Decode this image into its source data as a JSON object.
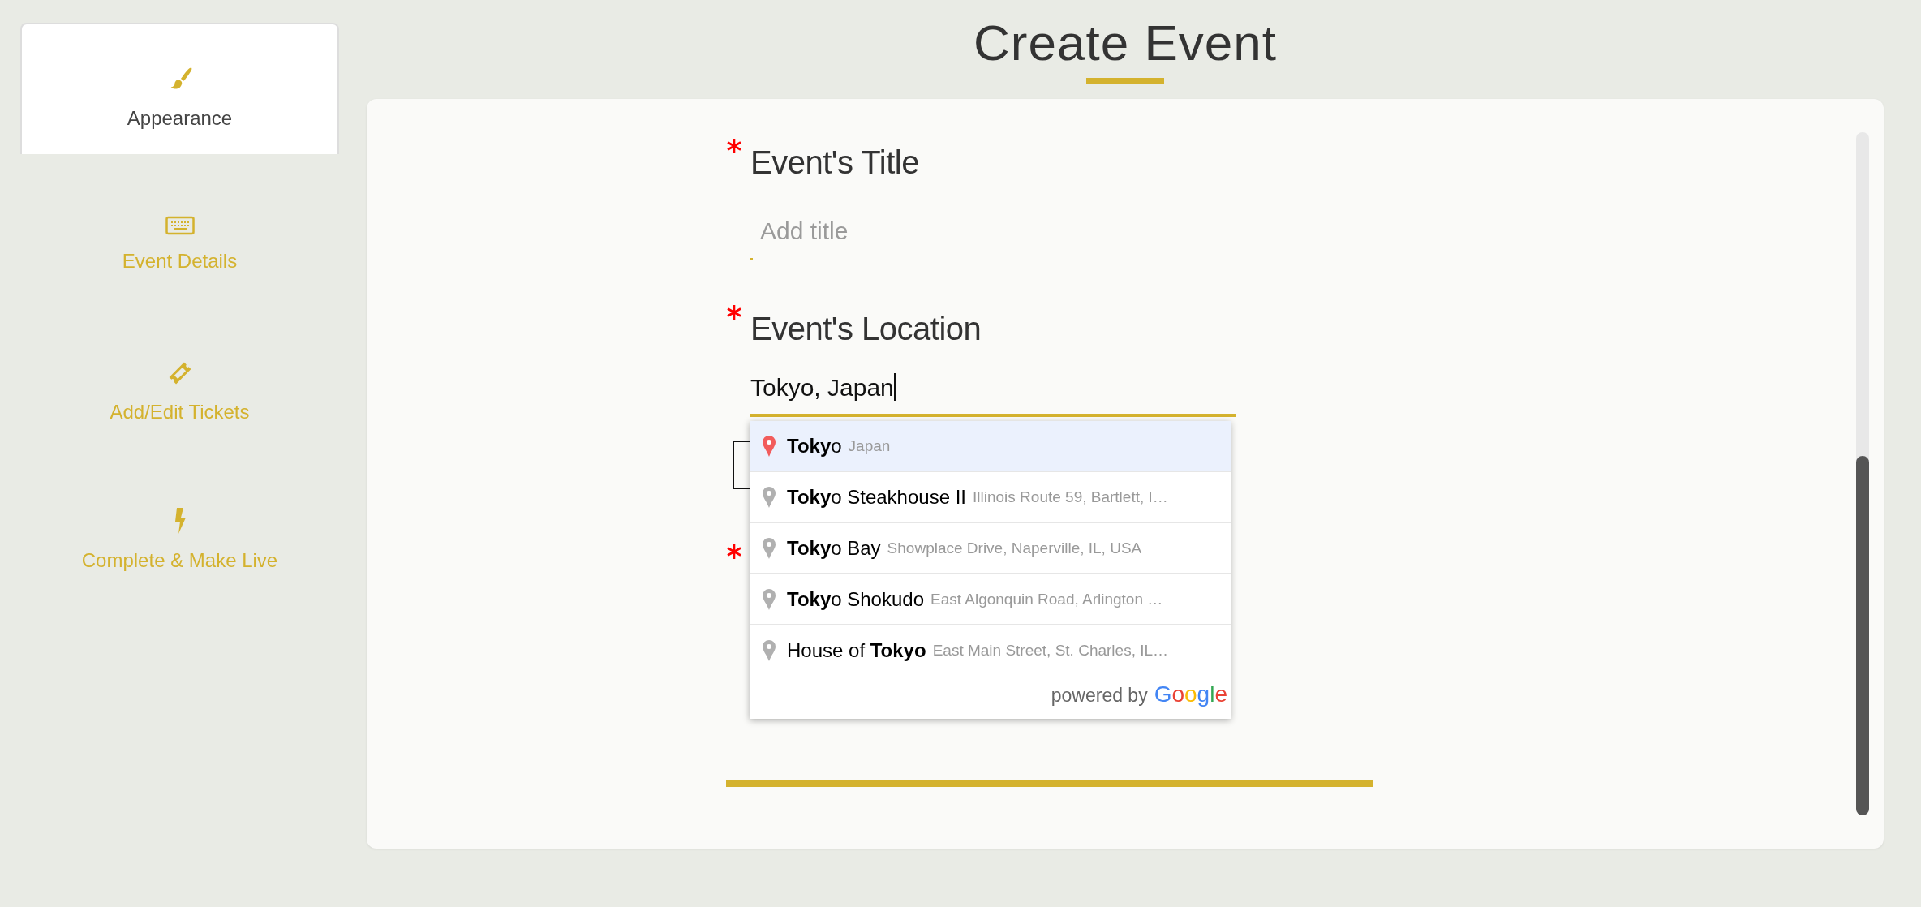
{
  "sidebar": {
    "items": [
      {
        "label": "Appearance",
        "selected": true
      },
      {
        "label": "Event Details",
        "selected": false
      },
      {
        "label": "Add/Edit Tickets",
        "selected": false
      },
      {
        "label": "Complete & Make Live",
        "selected": false
      }
    ]
  },
  "page_title": "Create Event",
  "form": {
    "fields": [
      {
        "label": "Event's Title",
        "required": true,
        "placeholder": "Add title"
      },
      {
        "label": "Event's Location",
        "required": true,
        "value": "Tokyo, Japan",
        "focused": true,
        "suggestions": [
          {
            "main": "**Toky**o",
            "secondary": "Japan",
            "selected": true
          },
          {
            "main": "**Toky**o Steakhouse II",
            "secondary": "Illinois Route 59, Bartlett, I…",
            "selected": false
          },
          {
            "main": "**Toky**o Bay",
            "secondary": "Showplace Drive, Naperville, IL, USA",
            "selected": false
          },
          {
            "main": "**Toky**o Shokudo",
            "secondary": "East Algonquin Road, Arlington …",
            "selected": false
          },
          {
            "main": "House of **Tokyo**",
            "secondary": "East Main Street, St. Charles, IL…",
            "selected": false
          }
        ],
        "attribution": {
          "prefix": "powered by",
          "brand": "Google"
        }
      },
      {
        "required": true
      }
    ]
  }
}
